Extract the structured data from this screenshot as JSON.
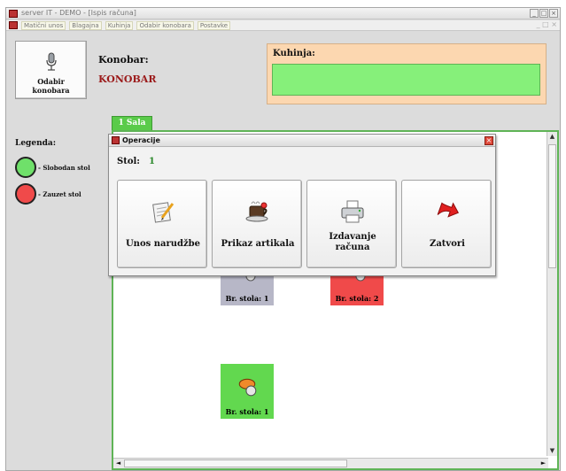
{
  "window": {
    "title": "server IT - DEMO - [Ispis računa]",
    "controls": [
      "_",
      "□",
      "×"
    ]
  },
  "menu": {
    "items": [
      "Matični unos",
      "Blagajna",
      "Kuhinja",
      "Odabir konobara",
      "Postavke"
    ],
    "right": "_ □ ×"
  },
  "waiter_button": {
    "line1": "Odabir",
    "line2": "konobara"
  },
  "waiter": {
    "label": "Konobar:",
    "name": "KONOBAR"
  },
  "kitchen": {
    "label": "Kuhinja:"
  },
  "legend": {
    "title": "Legenda:",
    "items": [
      {
        "text": "- Slobodan stol",
        "color": "#6fe06a"
      },
      {
        "text": "- Zauzet stol",
        "color": "#f04a4a"
      }
    ]
  },
  "tab": {
    "label": "1 Sala"
  },
  "tables": [
    {
      "label": "Br. stola: 1",
      "color": "#b7b7c7"
    },
    {
      "label": "Br. stola: 2",
      "color": "#f04a4a"
    },
    {
      "label": "Br. stola: 1",
      "color": "#62d84f"
    }
  ],
  "dialog": {
    "title": "Operacije",
    "close": "×",
    "stol_label": "Stol:",
    "stol_value": "1",
    "buttons": [
      {
        "line1": "Unos narudžbe",
        "line2": "",
        "icon": "order-entry-icon"
      },
      {
        "line1": "Prikaz artikala",
        "line2": "",
        "icon": "coffee-icon"
      },
      {
        "line1": "Izdavanje",
        "line2": "računa",
        "icon": "printer-icon"
      },
      {
        "line1": "Zatvori",
        "line2": "",
        "icon": "close-arrow-icon"
      }
    ]
  },
  "colors": {
    "accent_green": "#5acb4a",
    "kitchen_bg": "#fcd7b0",
    "kitchen_bar": "#86f07a",
    "waiter_name": "#9b1a1a"
  }
}
